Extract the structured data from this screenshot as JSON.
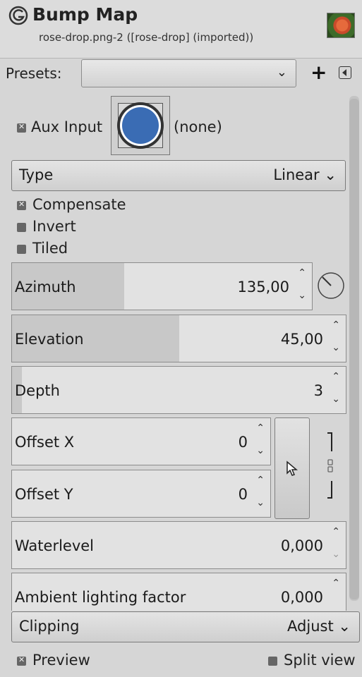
{
  "header": {
    "title": "Bump Map",
    "subtitle": "rose-drop.png-2 ([rose-drop] (imported))",
    "logo_icon": "gimp-logo-icon",
    "thumbnail_icon": "image-thumbnail"
  },
  "presets": {
    "label": "Presets:",
    "value": "",
    "add_label": "+",
    "menu_icon": "menu-triangle-icon"
  },
  "aux_input": {
    "label": "Aux Input",
    "checked": true,
    "value": "(none)",
    "swatch_color": "#3a6cb4"
  },
  "type": {
    "label": "Type",
    "value": "Linear"
  },
  "checks": {
    "compensate": {
      "label": "Compensate",
      "checked": true
    },
    "invert": {
      "label": "Invert",
      "checked": false
    },
    "tiled": {
      "label": "Tiled",
      "checked": false
    }
  },
  "fields": {
    "azimuth": {
      "label": "Azimuth",
      "value": "135,00",
      "fraction": 0.375
    },
    "elevation": {
      "label": "Elevation",
      "value": "45,00",
      "fraction": 0.5
    },
    "depth": {
      "label": "Depth",
      "value": "3",
      "fraction": 0.03
    },
    "offset_x": {
      "label": "Offset X",
      "value": "0"
    },
    "offset_y": {
      "label": "Offset Y",
      "value": "0"
    },
    "waterlevel": {
      "label": "Waterlevel",
      "value": "0,000"
    },
    "ambient": {
      "label": "Ambient lighting factor",
      "value": "0,000"
    }
  },
  "clipping": {
    "label": "Clipping",
    "value": "Adjust"
  },
  "preview": {
    "label": "Preview",
    "checked": true
  },
  "split_view": {
    "label": "Split view",
    "checked": false
  },
  "colors": {
    "accent": "#3a6cb4",
    "background": "#d6d6d6"
  }
}
